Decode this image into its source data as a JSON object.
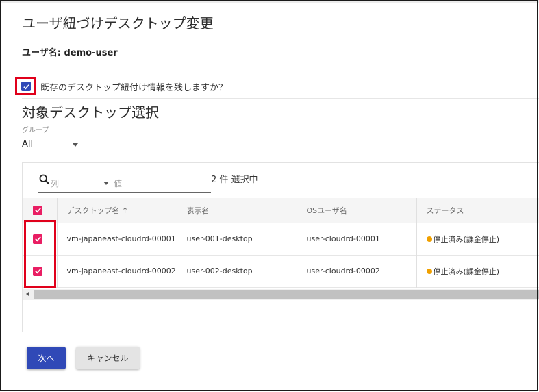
{
  "dialog": {
    "title": "ユーザ紐づけデスクトップ変更",
    "user_line": "ユーザ名: demo-user",
    "keep_checkbox": {
      "label": "既存のデスクトップ紐付け情報を残しますか？",
      "checked": true
    }
  },
  "section": {
    "title": "対象デスクトップ選択",
    "group": {
      "label": "グループ",
      "value": "All"
    }
  },
  "filter": {
    "column_placeholder": "列",
    "value_placeholder": "値",
    "selection_count": "2 件 選択中"
  },
  "table": {
    "columns": [
      "デスクトップ名 ↑",
      "表示名",
      "OSユーザ名",
      "ステータス"
    ],
    "rows": [
      {
        "checked": true,
        "desktop_name": "vm-japaneast-cloudrd-00001",
        "display_name": "user-001-desktop",
        "os_user": "user-cloudrd-00001",
        "status": "停止済み(課金停止)"
      },
      {
        "checked": true,
        "desktop_name": "vm-japaneast-cloudrd-00002",
        "display_name": "user-002-desktop",
        "os_user": "user-cloudrd-00002",
        "status": "停止済み(課金停止)"
      }
    ]
  },
  "buttons": {
    "next": "次へ",
    "cancel": "キャンセル"
  },
  "colors": {
    "primary": "#3049b7",
    "checkbox_pink": "#e91e63",
    "highlight_red": "#e0001b",
    "status_orange": "#f0a000"
  },
  "icons": [
    "check-icon",
    "search-icon",
    "dropdown-caret-icon",
    "sort-up-icon",
    "status-dot-icon",
    "scroll-left-icon"
  ]
}
